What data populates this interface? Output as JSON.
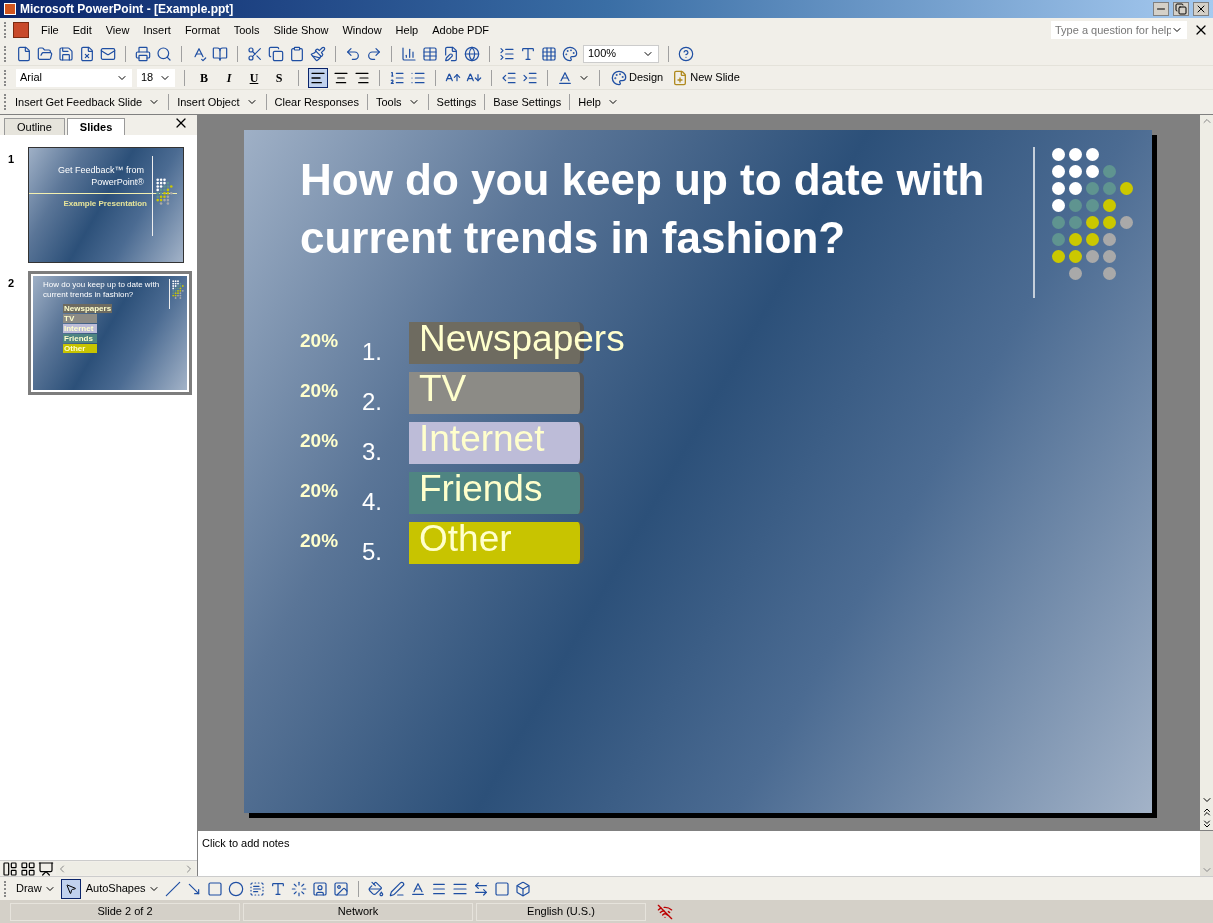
{
  "window": {
    "title": "Microsoft PowerPoint - [Example.ppt]"
  },
  "menu_bar": {
    "items": [
      "File",
      "Edit",
      "View",
      "Insert",
      "Format",
      "Tools",
      "Slide Show",
      "Window",
      "Help",
      "Adobe PDF"
    ],
    "help_search": {
      "placeholder": "Type a question for help"
    }
  },
  "standard_toolbar": {
    "zoom": "100%"
  },
  "formatting_toolbar": {
    "font": "Arial",
    "font_size": "18",
    "style_buttons": [
      "B",
      "I",
      "U",
      "S"
    ],
    "align_left_on": true,
    "buttons": [
      "Design",
      "New Slide"
    ]
  },
  "feedback_toolbar": {
    "items": [
      {
        "label": "Insert Get Feedback Slide",
        "dropdown": true
      },
      {
        "label": "Insert Object",
        "dropdown": true
      },
      {
        "label": "Clear Responses",
        "dropdown": false
      },
      {
        "label": "Tools",
        "dropdown": true
      },
      {
        "label": "Settings",
        "dropdown": false
      },
      {
        "label": "Base Settings",
        "dropdown": false
      },
      {
        "label": "Help",
        "dropdown": true
      }
    ]
  },
  "pane_tabs": [
    {
      "label": "Outline",
      "selected": false
    },
    {
      "label": "Slides",
      "selected": true
    }
  ],
  "thumbnails": [
    {
      "number": "1",
      "selected": false,
      "kind": "title",
      "title": "Get Feedback™ from PowerPoint®",
      "subtitle": "Example Presentation"
    },
    {
      "number": "2",
      "selected": true,
      "kind": "question",
      "title": "How do you keep up to date with current trends in fashion?",
      "options": [
        "Newspapers",
        "TV",
        "Internet",
        "Friends",
        "Other"
      ]
    }
  ],
  "slide": {
    "title": "How do you keep up to date with current trends in fashion?",
    "options": [
      {
        "percent": "20%",
        "number": "1.",
        "label": "Newspapers",
        "color": "#6e6b60"
      },
      {
        "percent": "20%",
        "number": "2.",
        "label": "TV",
        "color": "#8c8b86"
      },
      {
        "percent": "20%",
        "number": "3.",
        "label": "Internet",
        "color": "#bdbcd8"
      },
      {
        "percent": "20%",
        "number": "4.",
        "label": "Friends",
        "color": "#4f8582"
      },
      {
        "percent": "20%",
        "number": "5.",
        "label": "Other",
        "color": "#c8c400"
      }
    ]
  },
  "notes": {
    "placeholder": "Click to add notes"
  },
  "drawing_toolbar": {
    "items": [
      {
        "label": "Draw"
      },
      {
        "label": "AutoShapes"
      }
    ]
  },
  "status_bar": [
    "Slide 2 of 2",
    "Network",
    "English (U.S.)"
  ]
}
